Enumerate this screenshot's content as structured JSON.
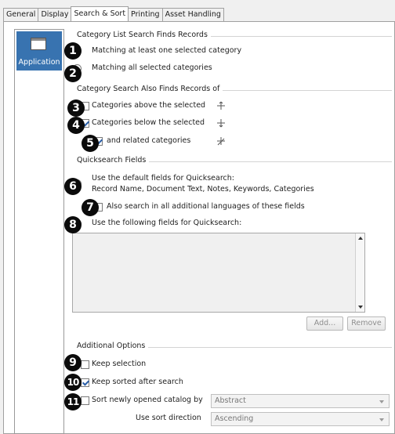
{
  "tabs": [
    "General",
    "Display",
    "Search & Sort",
    "Printing",
    "Asset Handling"
  ],
  "sidebar": {
    "item_label": "Application",
    "item_icon": "application-window-icon"
  },
  "category_list": {
    "legend": "Category List Search Finds Records",
    "options": [
      "Matching at least one selected category",
      "Matching all selected categories"
    ],
    "selected_index": 0
  },
  "category_search": {
    "legend": "Category Search Also Finds Records of",
    "above": {
      "label": "Categories above the selected",
      "checked": false,
      "icon": "tree-up-icon"
    },
    "below": {
      "label": "Categories below the selected",
      "checked": true,
      "icon": "tree-down-icon"
    },
    "related": {
      "label": "and related categories",
      "checked": true,
      "icon": "tree-related-icon"
    }
  },
  "quicksearch": {
    "legend": "Quicksearch Fields",
    "default_option": "Use the default fields for Quicksearch:",
    "default_fields": "Record Name, Document Text, Notes, Keywords, Categories",
    "also_languages": "Also search in all additional languages of these fields",
    "also_languages_checked": false,
    "following_option": "Use the following fields for Quicksearch:",
    "selected_option": "default",
    "add_button": "Add...",
    "remove_button": "Remove"
  },
  "additional": {
    "legend": "Additional Options",
    "keep_selection": {
      "label": "Keep selection",
      "checked": false
    },
    "keep_sorted": {
      "label": "Keep sorted after search",
      "checked": true
    },
    "sort_catalog": {
      "label": "Sort newly opened catalog by",
      "checked": false,
      "value": "Abstract"
    },
    "sort_direction": {
      "label": "Use sort direction",
      "value": "Ascending"
    }
  },
  "callouts": [
    "1",
    "2",
    "3",
    "4",
    "5",
    "6",
    "7",
    "8",
    "9",
    "10",
    "11"
  ],
  "colors": {
    "selection": "#3873b0",
    "badge": "#0b0b0b",
    "accent": "#2a5fa8"
  }
}
